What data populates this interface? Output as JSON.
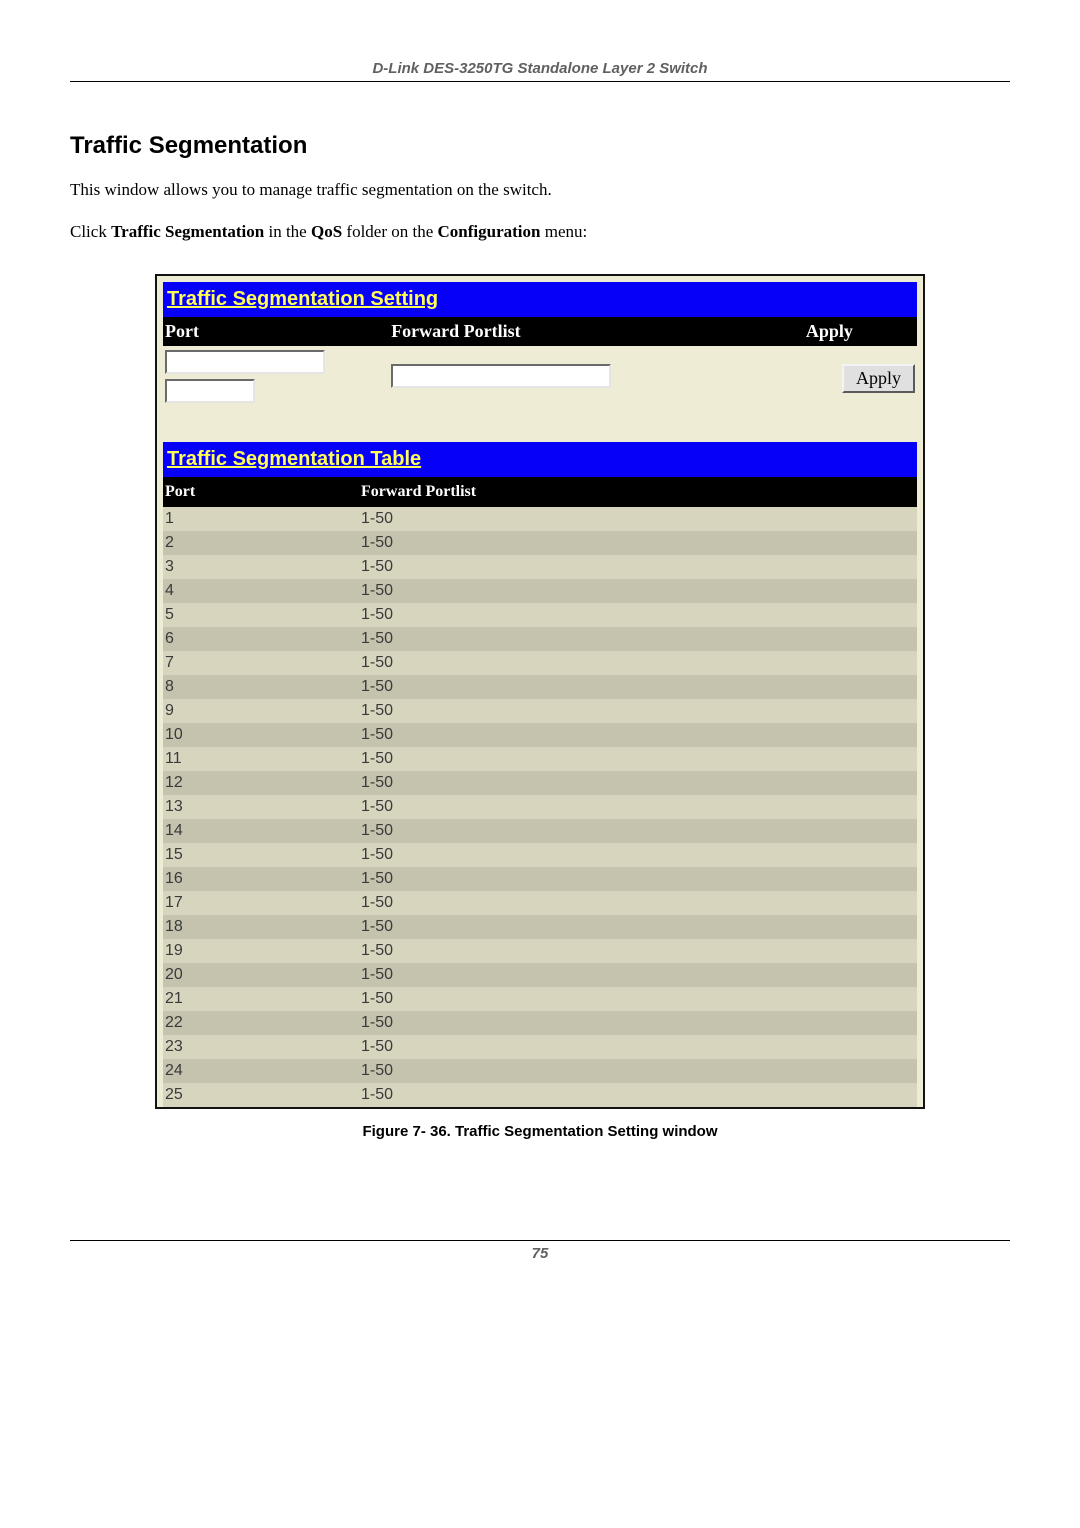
{
  "header": {
    "product": "D-Link DES-3250TG Standalone Layer 2 Switch"
  },
  "section": {
    "title": "Traffic Segmentation"
  },
  "intro": {
    "line1": "This window allows you to manage traffic segmentation on the switch.",
    "line2_pre": "Click ",
    "line2_b1": "Traffic Segmentation",
    "line2_mid1": " in the ",
    "line2_b2": "QoS",
    "line2_mid2": " folder on the ",
    "line2_b3": "Configuration",
    "line2_post": " menu:"
  },
  "panel": {
    "setting_title": "Traffic Segmentation Setting",
    "table_title": "Traffic Segmentation Table",
    "cols": {
      "port": "Port",
      "forward": "Forward Portlist",
      "apply": "Apply"
    },
    "apply_btn": "Apply"
  },
  "rows": [
    {
      "port": "1",
      "fwd": "1-50"
    },
    {
      "port": "2",
      "fwd": "1-50"
    },
    {
      "port": "3",
      "fwd": "1-50"
    },
    {
      "port": "4",
      "fwd": "1-50"
    },
    {
      "port": "5",
      "fwd": "1-50"
    },
    {
      "port": "6",
      "fwd": "1-50"
    },
    {
      "port": "7",
      "fwd": "1-50"
    },
    {
      "port": "8",
      "fwd": "1-50"
    },
    {
      "port": "9",
      "fwd": "1-50"
    },
    {
      "port": "10",
      "fwd": "1-50"
    },
    {
      "port": "11",
      "fwd": "1-50"
    },
    {
      "port": "12",
      "fwd": "1-50"
    },
    {
      "port": "13",
      "fwd": "1-50"
    },
    {
      "port": "14",
      "fwd": "1-50"
    },
    {
      "port": "15",
      "fwd": "1-50"
    },
    {
      "port": "16",
      "fwd": "1-50"
    },
    {
      "port": "17",
      "fwd": "1-50"
    },
    {
      "port": "18",
      "fwd": "1-50"
    },
    {
      "port": "19",
      "fwd": "1-50"
    },
    {
      "port": "20",
      "fwd": "1-50"
    },
    {
      "port": "21",
      "fwd": "1-50"
    },
    {
      "port": "22",
      "fwd": "1-50"
    },
    {
      "port": "23",
      "fwd": "1-50"
    },
    {
      "port": "24",
      "fwd": "1-50"
    },
    {
      "port": "25",
      "fwd": "1-50"
    }
  ],
  "caption": "Figure 7- 36.  Traffic Segmentation Setting window",
  "footer": {
    "page": "75"
  }
}
